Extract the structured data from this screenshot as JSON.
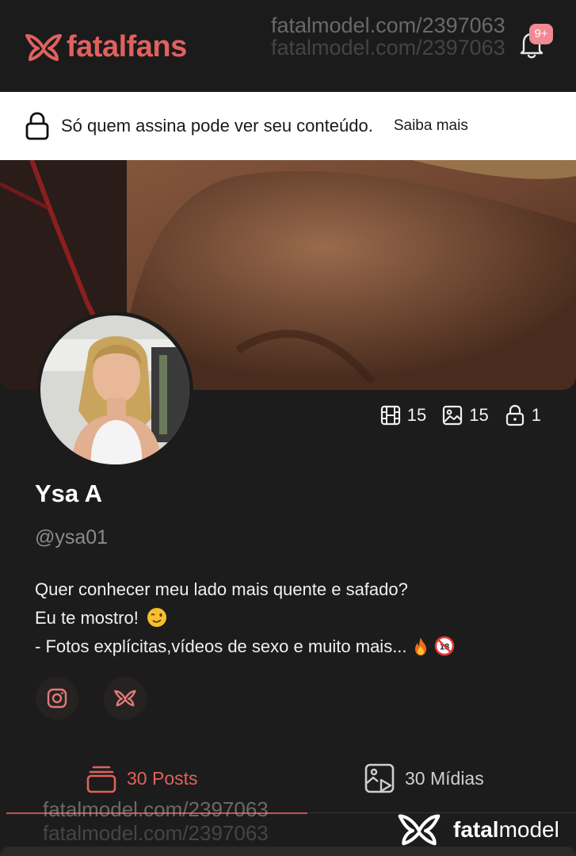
{
  "header": {
    "logo_text_1": "fatal",
    "logo_text_2": "fans",
    "notifications_badge": "9+",
    "watermark": "fatalmodel.com/2397063"
  },
  "notice": {
    "message": "Só quem assina pode ver seu conteúdo.",
    "link": "Saiba mais"
  },
  "stats": {
    "videos": "15",
    "photos": "15",
    "locked": "1"
  },
  "profile": {
    "name": "Ysa A",
    "handle": "@ysa01",
    "bio_line1": "Quer conhecer meu lado mais quente e safado?",
    "bio_line2": "Eu te mostro!",
    "bio_line3": "- Fotos explícitas,vídeos de sexo e muito mais..."
  },
  "socials": [
    "instagram-icon",
    "fatal-logo-icon"
  ],
  "tabs": {
    "posts": "30 Posts",
    "media": "30 Mídias"
  },
  "footer": {
    "watermark": "fatalmodel.com/2397063",
    "brand_bold": "fatal",
    "brand_rest": "model"
  },
  "colors": {
    "accent": "#e0615e",
    "background": "#1c1c1c",
    "badge": "#f08a93"
  }
}
